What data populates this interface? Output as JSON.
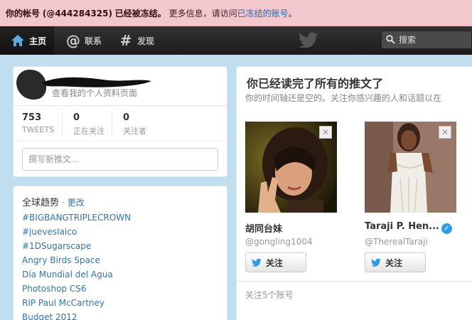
{
  "banner": {
    "prefix": "你的帐号",
    "account": "(@444284325)",
    "status": "已经被冻结。",
    "info": "更多信息，请访问",
    "link": "已冻结的账号",
    "end": "。"
  },
  "nav": {
    "home": "主页",
    "connect": "联系",
    "discover": "发现",
    "search_placeholder": "搜索"
  },
  "profile": {
    "view_profile": "查看我的个人资料页面",
    "stats": [
      {
        "value": "753",
        "label": "TWEETS"
      },
      {
        "value": "0",
        "label": "正在关注"
      },
      {
        "value": "0",
        "label": "关注者"
      }
    ],
    "compose_placeholder": "撰写新推文..."
  },
  "trends": {
    "title": "全球趋势",
    "change": "· 更改",
    "items": [
      "#BIGBANGTRIPLECROWN",
      "#juevesIaico",
      "#1DSugarscape",
      "Angry Birds Space",
      "Día Mundial del Agua",
      "Photoshop CS6",
      "RIP Paul McCartney",
      "Budget 2012"
    ]
  },
  "timeline": {
    "title": "你已经读完了所有的推文了",
    "subtitle": "你的时间轴还是空的。关注你感兴趣的人和话题以在",
    "suggestions": [
      {
        "name": "胡同台妹",
        "handle": "@gongling1004",
        "follow": "关注",
        "verified": false
      },
      {
        "name": "Taraji P. Hen...",
        "handle": "@TherealTaraji",
        "follow": "关注",
        "verified": true
      }
    ],
    "follow_count": "关注5个账号"
  },
  "colors": {
    "background": "#c0deed",
    "banner": "#f2c8cc",
    "link": "#2d76b5",
    "verified": "#2b9de8"
  }
}
